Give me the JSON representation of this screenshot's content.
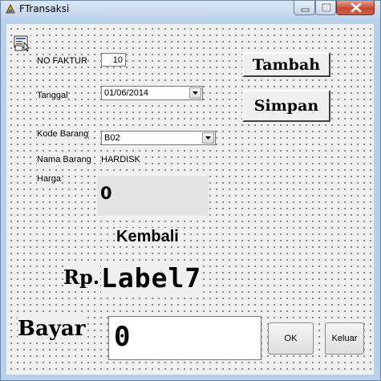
{
  "window": {
    "title": "FTransaksi"
  },
  "form": {
    "no_faktur": {
      "label": "NO FAKTUR",
      "value": "10"
    },
    "tanggal": {
      "label": "Tanggal",
      "value": "01/06/2014"
    },
    "kode_barang": {
      "label": "Kode Barang",
      "value": "B02"
    },
    "nama_barang": {
      "label": "Nama Barang",
      "value": "HARDISK"
    },
    "harga": {
      "label": "Harga",
      "value": "0"
    }
  },
  "buttons": {
    "tambah": "Tambah",
    "simpan": "Simpan",
    "ok": "OK",
    "keluar": "Keluar"
  },
  "kembali": {
    "title": "Kembali",
    "prefix": "Rp.",
    "value": "Label7"
  },
  "bayar": {
    "label": "Bayar",
    "value": "0"
  },
  "colors": {
    "titlebar": "#bfd3ea",
    "close_button": "#c74a32",
    "form_background": "#f0f0f0"
  },
  "icons": {
    "app": "delphi-app-icon",
    "toolbar": "data-control-icon"
  }
}
